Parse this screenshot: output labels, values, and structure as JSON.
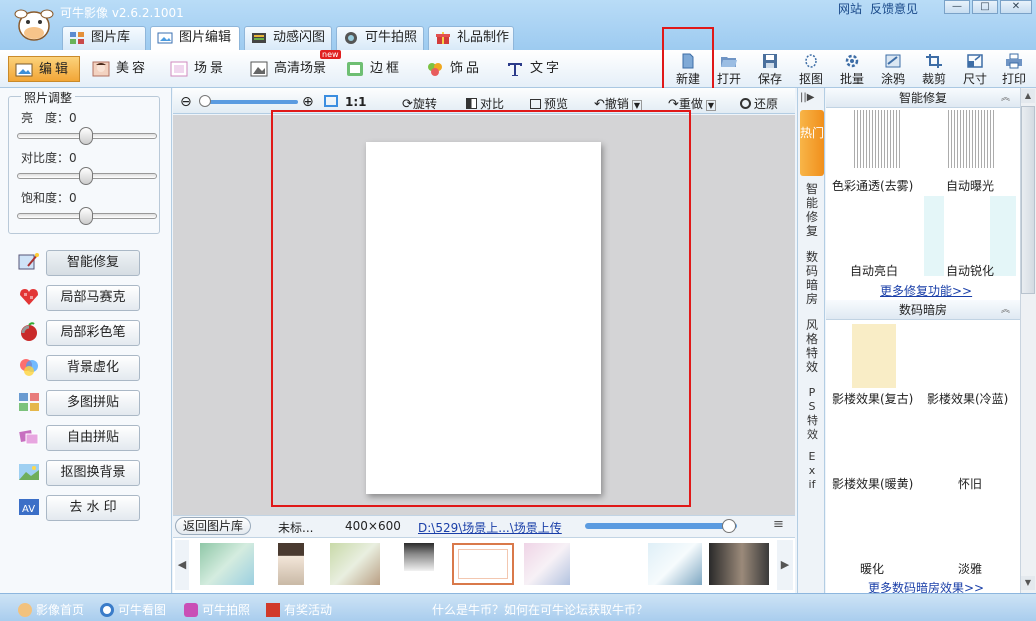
{
  "app": {
    "title": "可牛影像 v2.6.2.1001",
    "links": [
      "网站",
      "反馈意见"
    ],
    "window_buttons": [
      "—",
      "□",
      "✕"
    ]
  },
  "main_tabs": [
    {
      "label": "图片库",
      "icon": "gallery-icon"
    },
    {
      "label": "图片编辑",
      "icon": "image-edit-icon",
      "active": true
    },
    {
      "label": "动感闪图",
      "icon": "film-icon"
    },
    {
      "label": "可牛拍照",
      "icon": "camera-icon"
    },
    {
      "label": "礼品制作",
      "icon": "gift-icon"
    }
  ],
  "edit_tools": [
    {
      "label": "编辑",
      "icon": "edit-icon",
      "active": true
    },
    {
      "label": "美容",
      "icon": "face-icon"
    },
    {
      "label": "场景",
      "icon": "scene-icon"
    },
    {
      "label": "高清场景",
      "icon": "hd-scene-icon",
      "badge": "new"
    },
    {
      "label": "边框",
      "icon": "frame-icon"
    },
    {
      "label": "饰品",
      "icon": "decoration-icon"
    },
    {
      "label": "文字",
      "icon": "text-icon"
    }
  ],
  "file_tools": [
    {
      "label": "新建",
      "icon": "new-file-icon"
    },
    {
      "label": "打开",
      "icon": "open-folder-icon"
    },
    {
      "label": "保存",
      "icon": "save-icon"
    },
    {
      "label": "抠图",
      "icon": "cutout-icon"
    },
    {
      "label": "批量",
      "icon": "batch-icon"
    },
    {
      "label": "涂鸦",
      "icon": "doodle-icon"
    },
    {
      "label": "裁剪",
      "icon": "crop-icon"
    },
    {
      "label": "尺寸",
      "icon": "resize-icon"
    },
    {
      "label": "打印",
      "icon": "print-icon"
    }
  ],
  "photo_adjust": {
    "title": "照片调整",
    "sliders": [
      {
        "label": "亮　度：",
        "value": "0"
      },
      {
        "label": "对比度：",
        "value": "0"
      },
      {
        "label": "饱和度：",
        "value": "0"
      }
    ]
  },
  "left_buttons": [
    {
      "label": "智能修复",
      "icon": "magic-wand-icon"
    },
    {
      "label": "局部马赛克",
      "icon": "mosaic-icon"
    },
    {
      "label": "局部彩色笔",
      "icon": "color-pen-icon"
    },
    {
      "label": "背景虚化",
      "icon": "blur-icon"
    },
    {
      "label": "多图拼贴",
      "icon": "multi-collage-icon"
    },
    {
      "label": "自由拼贴",
      "icon": "free-collage-icon"
    },
    {
      "label": "抠图换背景",
      "icon": "replace-background-icon"
    },
    {
      "label": "去 水 印",
      "icon": "watermark-icon"
    }
  ],
  "canvas_toolbar": {
    "zoom_label": "1:1",
    "rotate": "旋转",
    "compare": "对比",
    "preview": "预览",
    "undo": "撤销",
    "redo": "重做",
    "restore": "还原"
  },
  "status": {
    "back_button": "返回图片库",
    "filename": "未标...",
    "dimensions": "400×600",
    "path": "D:\\529\\场景上...\\场景上传"
  },
  "vertical_tabs": [
    {
      "label": "热门",
      "active": true
    },
    {
      "label": "智能修复"
    },
    {
      "label": "数码暗房"
    },
    {
      "label": "风格特效"
    },
    {
      "label": "PS特效"
    },
    {
      "label": "Exif"
    }
  ],
  "right_panel": {
    "section1": {
      "title": "智能修复",
      "items": [
        "色彩通透(去雾)",
        "自动曝光",
        "自动亮白",
        "自动锐化"
      ],
      "more": "更多修复功能>>"
    },
    "section2": {
      "title": "数码暗房",
      "items": [
        "影楼效果(复古)",
        "影楼效果(冷蓝)",
        "影楼效果(暖黄)",
        "怀旧",
        "暖化",
        "淡雅"
      ],
      "more": "更多数码暗房效果>>"
    }
  },
  "bottom_bar": {
    "links": [
      "影像首页",
      "可牛看图",
      "可牛拍照",
      "有奖活动"
    ],
    "notice": "什么是牛币？如何在可牛论坛获取牛币？"
  },
  "colors": {
    "accent": "#f08f1c",
    "highlight_box": "#e01818",
    "link": "#1a3fa8"
  }
}
